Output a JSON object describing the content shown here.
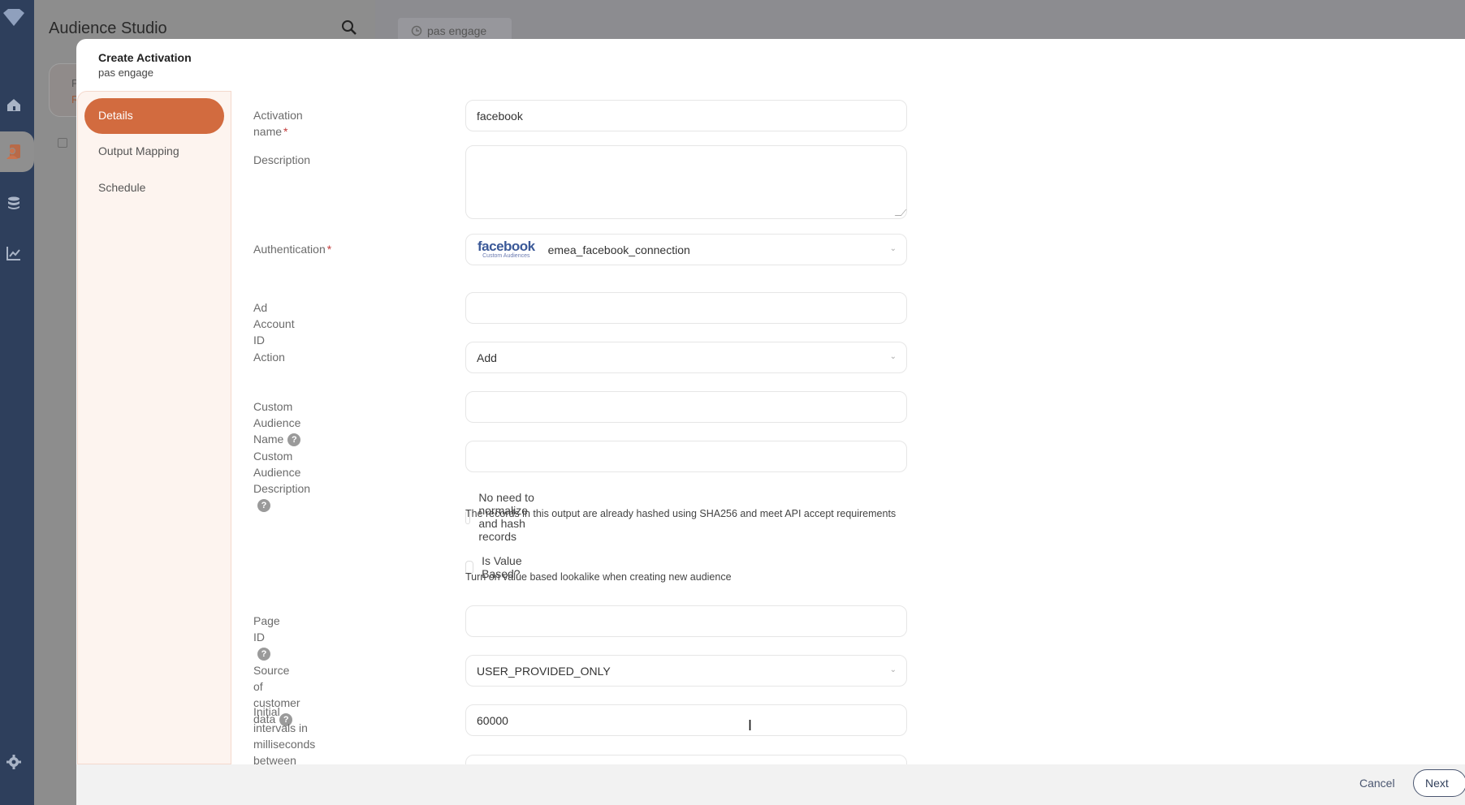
{
  "app": {
    "title": "Audience Studio",
    "open_tab": "pas engage",
    "background_card_letters": [
      "P",
      "R"
    ]
  },
  "rail": {
    "items": [
      {
        "name": "home",
        "icon": "home-icon"
      },
      {
        "name": "audiences",
        "icon": "audience-icon",
        "active": true
      },
      {
        "name": "data",
        "icon": "database-icon"
      },
      {
        "name": "analytics",
        "icon": "chart-icon"
      },
      {
        "name": "settings",
        "icon": "gear-icon"
      }
    ]
  },
  "modal": {
    "title": "Create Activation",
    "subtitle": "pas engage",
    "steps": [
      {
        "label": "Details",
        "active": true
      },
      {
        "label": "Output Mapping",
        "active": false
      },
      {
        "label": "Schedule",
        "active": false
      }
    ],
    "fields": {
      "activation_name": {
        "label": "Activation name",
        "required": true,
        "value": "facebook"
      },
      "description": {
        "label": "Description",
        "value": ""
      },
      "authentication": {
        "label": "Authentication",
        "required": true,
        "value": "emea_facebook_connection",
        "logo_word": "facebook",
        "logo_sub": "Custom Audiences"
      },
      "ad_account_id": {
        "label": "Ad Account ID",
        "value": ""
      },
      "action": {
        "label": "Action",
        "value": "Add"
      },
      "custom_audience_name": {
        "label": "Custom Audience Name",
        "value": ""
      },
      "custom_audience_description": {
        "label": "Custom Audience Description",
        "value": ""
      },
      "no_normalize": {
        "label": "No need to normalize and hash records",
        "checked": false,
        "description": "The records in this output are already hashed using SHA256 and meet API accept requirements"
      },
      "value_based": {
        "label": "Is Value Based?",
        "checked": false,
        "description": "Turn on value based lookalike when creating new audience"
      },
      "page_id": {
        "label": "Page ID",
        "value": ""
      },
      "source_of_customer_data": {
        "label": "Source of customer data",
        "value": "USER_PROVIDED_ONLY"
      },
      "initial_intervals": {
        "label_line1": "Initial intervals in milliseconds",
        "label_line2": "between retries",
        "value": "60000"
      }
    },
    "help_glyph": "?",
    "required_mark": "*",
    "footer": {
      "cancel": "Cancel",
      "next": "Next"
    }
  }
}
